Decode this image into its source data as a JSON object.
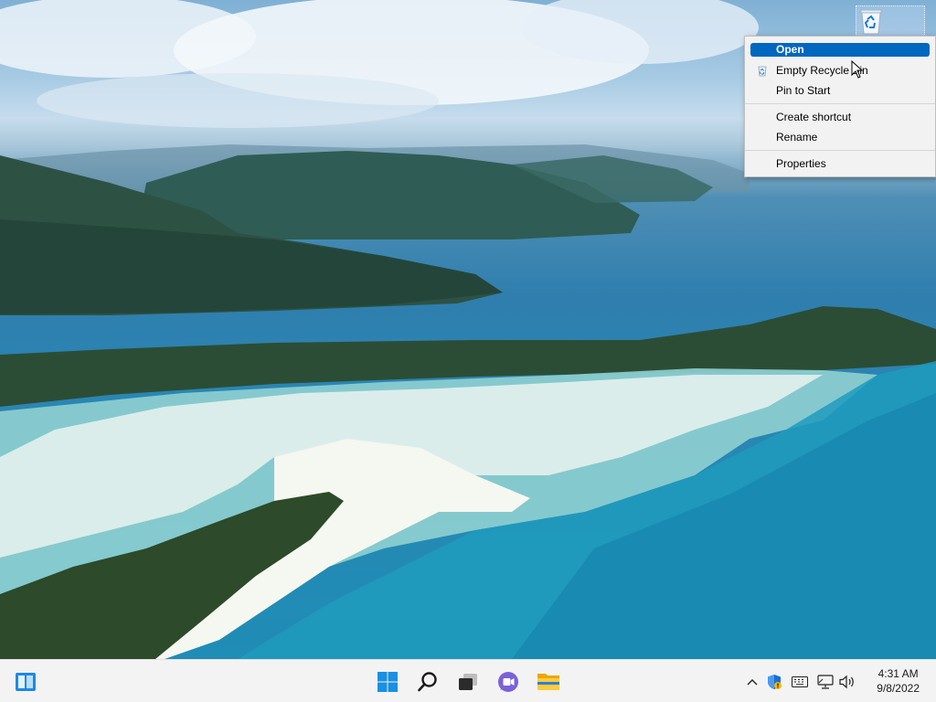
{
  "context_menu": {
    "items": [
      {
        "label": "Open",
        "selected": true
      },
      {
        "label": "Empty Recycle Bin",
        "icon": "recycle-bin-icon"
      },
      {
        "label": "Pin to Start"
      },
      {
        "label": "Create shortcut"
      },
      {
        "label": "Rename"
      },
      {
        "label": "Properties"
      }
    ]
  },
  "desktop": {
    "icons": [
      {
        "name": "Recycle Bin",
        "icon": "recycle-bin-icon"
      }
    ]
  },
  "taskbar": {
    "pinned": [
      {
        "name": "widgets",
        "icon": "widgets-icon"
      },
      {
        "name": "start",
        "icon": "windows-logo-icon"
      },
      {
        "name": "search",
        "icon": "search-icon"
      },
      {
        "name": "task-view",
        "icon": "task-view-icon"
      },
      {
        "name": "chat",
        "icon": "chat-icon"
      },
      {
        "name": "file-explorer",
        "icon": "folder-icon"
      }
    ],
    "tray_icons": [
      "chevron-up-icon",
      "shield-icon",
      "keyboard-icon",
      "network-icon",
      "volume-icon"
    ],
    "clock": {
      "time": "4:31 AM",
      "date": "9/8/2022"
    }
  },
  "colors": {
    "accent": "#0067c0",
    "taskbar_bg": "#f3f3f3",
    "menu_bg": "#f2f2f2"
  }
}
